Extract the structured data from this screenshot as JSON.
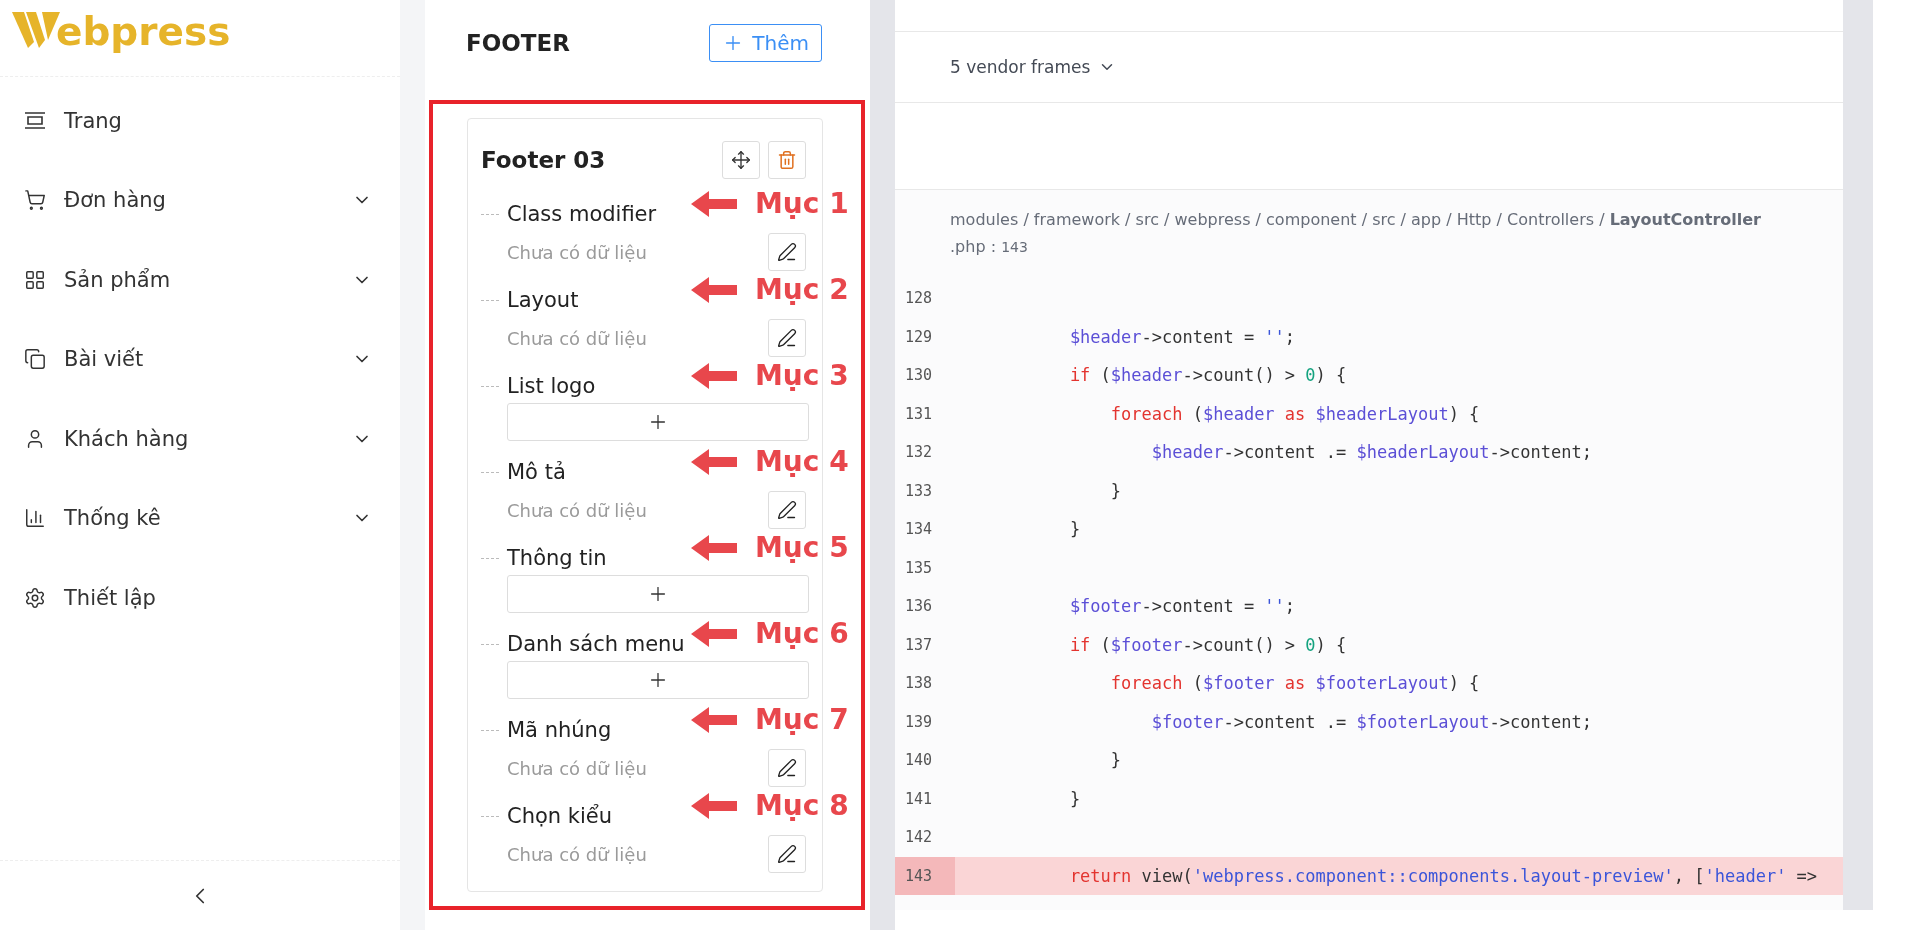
{
  "sidebar": {
    "logo_text": "ebpress",
    "items": [
      {
        "label": "Trang",
        "has_submenu": false
      },
      {
        "label": "Đơn hàng",
        "has_submenu": true
      },
      {
        "label": "Sản phẩm",
        "has_submenu": true
      },
      {
        "label": "Bài viết",
        "has_submenu": true
      },
      {
        "label": "Khách hàng",
        "has_submenu": true
      },
      {
        "label": "Thống kê",
        "has_submenu": true
      },
      {
        "label": "Thiết lập",
        "has_submenu": false
      }
    ]
  },
  "footer_panel": {
    "title": "FOOTER",
    "add_button": "Thêm",
    "card": {
      "title": "Footer 03",
      "fields": [
        {
          "label": "Class modifier",
          "kind": "text",
          "value": "Chưa có dữ liệu",
          "annotation": "Mục 1"
        },
        {
          "label": "Layout",
          "kind": "text",
          "value": "Chưa có dữ liệu",
          "annotation": "Mục 2"
        },
        {
          "label": "List logo",
          "kind": "list",
          "annotation": "Mục 3"
        },
        {
          "label": "Mô tả",
          "kind": "text",
          "value": "Chưa có dữ liệu",
          "annotation": "Mục 4"
        },
        {
          "label": "Thông tin",
          "kind": "list",
          "annotation": "Mục 5"
        },
        {
          "label": "Danh sách menu",
          "kind": "list",
          "annotation": "Mục 6"
        },
        {
          "label": "Mã nhúng",
          "kind": "text",
          "value": "Chưa có dữ liệu",
          "annotation": "Mục 7"
        },
        {
          "label": "Chọn kiểu",
          "kind": "text",
          "value": "Chưa có dữ liệu",
          "annotation": "Mục 8"
        }
      ]
    }
  },
  "error_page": {
    "vendor_frames": "5 vendor frames",
    "file_path": "modules / framework / src / webpress / component / src / app / Http / Controllers / ",
    "file_name": "LayoutController",
    "file_ext": ".php",
    "line_sep": ":",
    "line_ref": "143",
    "code_lines": [
      {
        "number": "128",
        "selected": false
      },
      {
        "number": "129",
        "selected": false,
        "tokens": [
          {
            "kind": "var",
            "s": "        $header"
          },
          {
            "kind": "plain",
            "s": "->content = "
          },
          {
            "kind": "str",
            "s": "''"
          },
          {
            "kind": "plain",
            "s": ";"
          }
        ]
      },
      {
        "number": "130",
        "selected": false,
        "tokens": [
          {
            "kind": "kw",
            "s": "        if"
          },
          {
            "kind": "plain",
            "s": " ("
          },
          {
            "kind": "var",
            "s": "$header"
          },
          {
            "kind": "plain",
            "s": "->count() > "
          },
          {
            "kind": "num",
            "s": "0"
          },
          {
            "kind": "plain",
            "s": ") {"
          }
        ]
      },
      {
        "number": "131",
        "selected": false,
        "tokens": [
          {
            "kind": "kw",
            "s": "            foreach"
          },
          {
            "kind": "plain",
            "s": " ("
          },
          {
            "kind": "var",
            "s": "$header"
          },
          {
            "kind": "kw",
            "s": " as "
          },
          {
            "kind": "var",
            "s": "$headerLayout"
          },
          {
            "kind": "plain",
            "s": ") {"
          }
        ]
      },
      {
        "number": "132",
        "selected": false,
        "tokens": [
          {
            "kind": "var",
            "s": "                $header"
          },
          {
            "kind": "plain",
            "s": "->content .= "
          },
          {
            "kind": "var",
            "s": "$headerLayout"
          },
          {
            "kind": "plain",
            "s": "->content;"
          }
        ]
      },
      {
        "number": "133",
        "selected": false,
        "tokens": [
          {
            "kind": "plain",
            "s": "            }"
          }
        ]
      },
      {
        "number": "134",
        "selected": false,
        "tokens": [
          {
            "kind": "plain",
            "s": "        }"
          }
        ]
      },
      {
        "number": "135",
        "selected": false
      },
      {
        "number": "136",
        "selected": false,
        "tokens": [
          {
            "kind": "var",
            "s": "        $footer"
          },
          {
            "kind": "plain",
            "s": "->content = "
          },
          {
            "kind": "str",
            "s": "''"
          },
          {
            "kind": "plain",
            "s": ";"
          }
        ]
      },
      {
        "number": "137",
        "selected": false,
        "tokens": [
          {
            "kind": "kw",
            "s": "        if"
          },
          {
            "kind": "plain",
            "s": " ("
          },
          {
            "kind": "var",
            "s": "$footer"
          },
          {
            "kind": "plain",
            "s": "->count() > "
          },
          {
            "kind": "num",
            "s": "0"
          },
          {
            "kind": "plain",
            "s": ") {"
          }
        ]
      },
      {
        "number": "138",
        "selected": false,
        "tokens": [
          {
            "kind": "kw",
            "s": "            foreach"
          },
          {
            "kind": "plain",
            "s": " ("
          },
          {
            "kind": "var",
            "s": "$footer"
          },
          {
            "kind": "kw",
            "s": " as "
          },
          {
            "kind": "var",
            "s": "$footerLayout"
          },
          {
            "kind": "plain",
            "s": ") {"
          }
        ]
      },
      {
        "number": "139",
        "selected": false,
        "tokens": [
          {
            "kind": "var",
            "s": "                $footer"
          },
          {
            "kind": "plain",
            "s": "->content .= "
          },
          {
            "kind": "var",
            "s": "$footerLayout"
          },
          {
            "kind": "plain",
            "s": "->content;"
          }
        ]
      },
      {
        "number": "140",
        "selected": false,
        "tokens": [
          {
            "kind": "plain",
            "s": "            }"
          }
        ]
      },
      {
        "number": "141",
        "selected": false,
        "tokens": [
          {
            "kind": "plain",
            "s": "        }"
          }
        ]
      },
      {
        "number": "142",
        "selected": false
      },
      {
        "number": "143",
        "selected": true,
        "tokens": [
          {
            "kind": "kw",
            "s": "        return"
          },
          {
            "kind": "plain",
            "s": " view("
          },
          {
            "kind": "str",
            "s": "'webpress.component::components.layout-preview'"
          },
          {
            "kind": "plain",
            "s": ", ["
          },
          {
            "kind": "str",
            "s": "'header'"
          },
          {
            "kind": "plain",
            "s": " =>"
          }
        ]
      }
    ]
  }
}
